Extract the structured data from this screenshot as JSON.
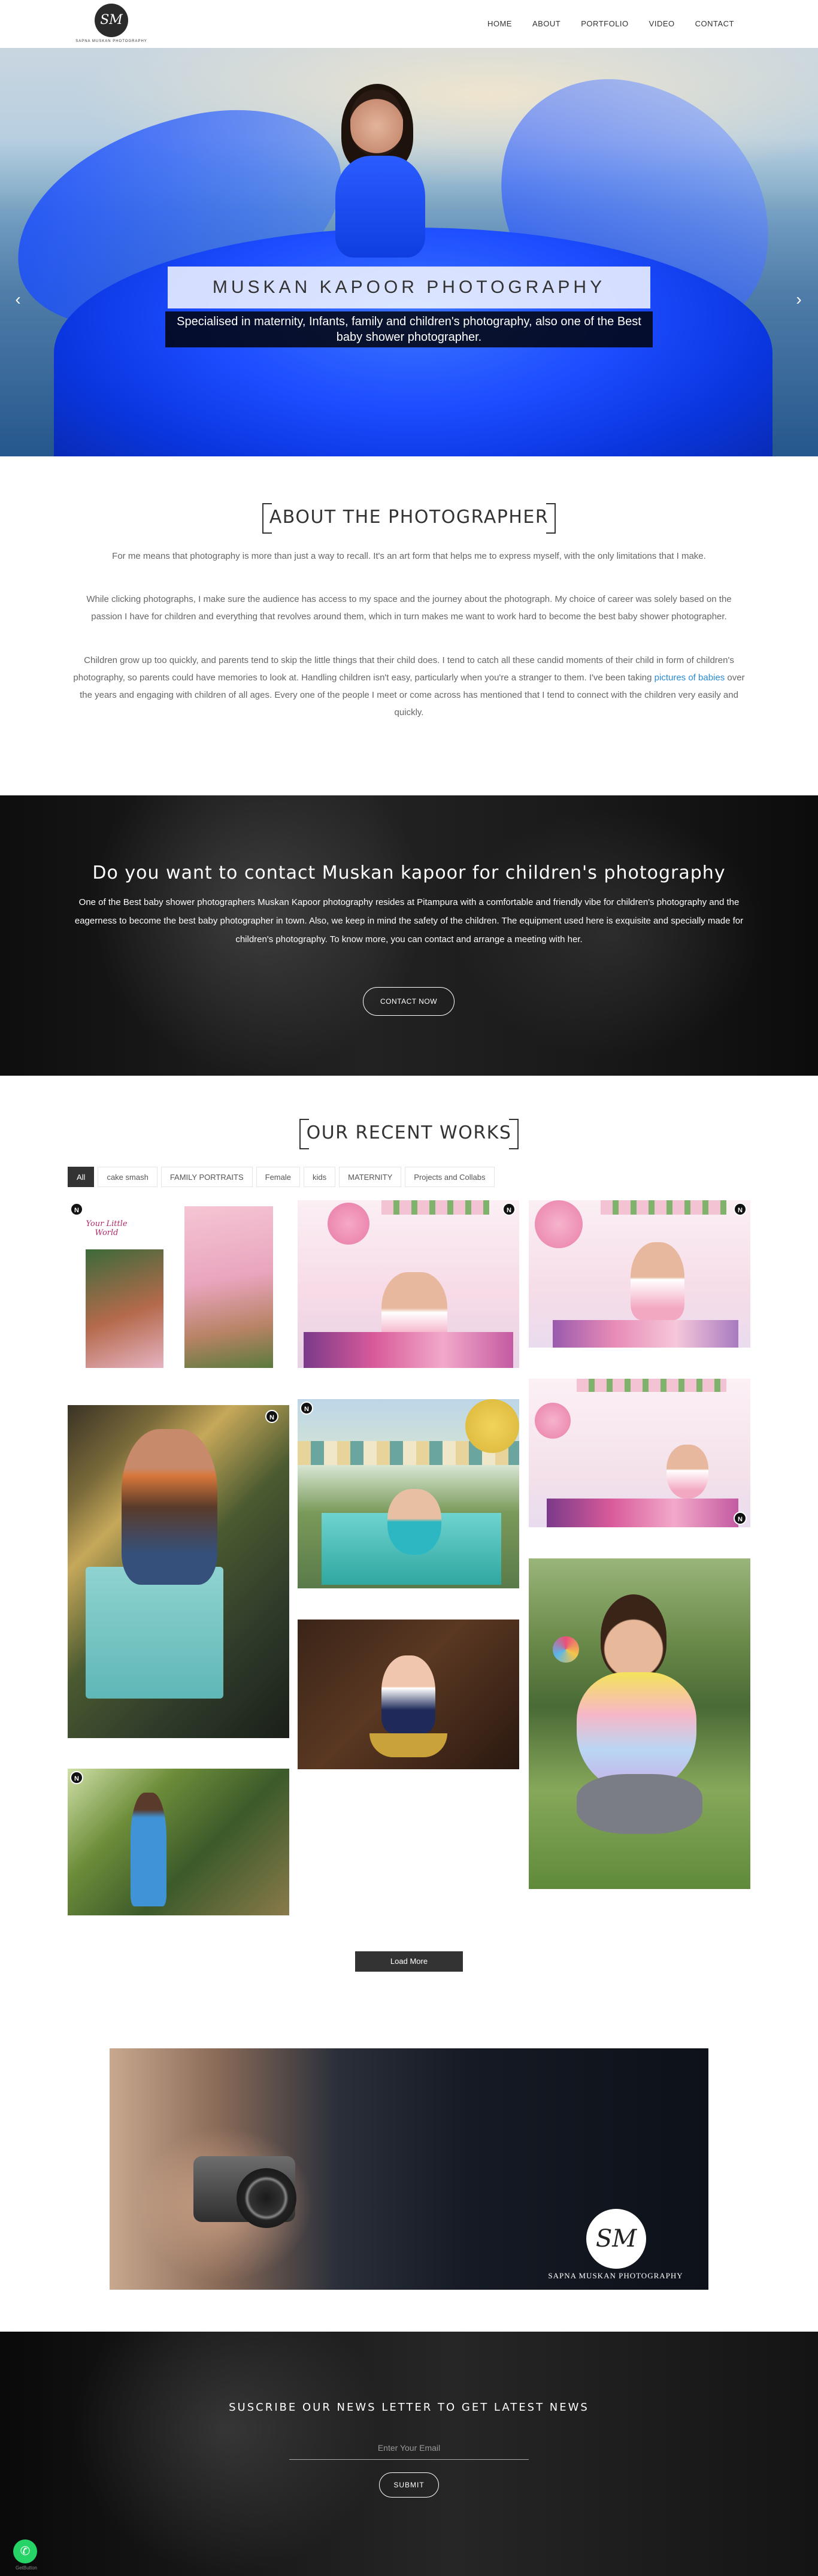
{
  "header": {
    "logo_initials": "SM",
    "logo_text": "SAPNA MUSKAN PHOTOGRAPHY",
    "nav": [
      "HOME",
      "ABOUT",
      "PORTFOLIO",
      "VIDEO",
      "CONTACT"
    ]
  },
  "hero": {
    "title": "MUSKAN KAPOOR PHOTOGRAPHY",
    "subtitle": "Specialised in maternity, Infants, family and children's photography, also one of the Best baby shower photographer.",
    "prev_arrow": "‹",
    "next_arrow": "›"
  },
  "about": {
    "heading": "ABOUT THE PHOTOGRAPHER",
    "p1": "For me means that photography is more than just a way to recall. It's an art form that helps me to express myself, with the only limitations that I make.",
    "p2": "While clicking photographs, I make sure the audience has access to my space and the journey about the photograph. My choice of career was solely based on the passion I have for children and everything that revolves around them, which in turn makes me want to work hard to become the best baby shower photographer.",
    "p3_before": "Children grow up too quickly, and parents tend to skip the little things that their child does. I tend to catch all these candid moments of their child in form of children's photography, so parents could have memories to look at. Handling children isn't easy, particularly when you're a stranger to them. I've been taking ",
    "p3_link": "pictures of babies",
    "p3_after": " over the years and engaging with children of all ages. Every one of the people I meet or come across has mentioned that I tend to connect with the children very easily and quickly."
  },
  "contact": {
    "heading": "Do you want to contact Muskan kapoor for children's photography",
    "text": "One of the Best baby shower photographers Muskan Kapoor photography resides at Pitampura with a comfortable and friendly vibe for children's photography and the eagerness to become the best baby photographer in town. Also, we keep in mind the safety of the children. The equipment used here is exquisite and specially made for children's photography. To know more, you can contact and arrange a meeting with her.",
    "button": "CONTACT NOW"
  },
  "works": {
    "heading": "OUR RECENT WORKS",
    "filters": [
      "All",
      "cake smash",
      "FAMILY PORTRAITS",
      "Female",
      "kids",
      "MATERNITY",
      "Projects and Collabs"
    ],
    "active_filter": "All",
    "badge_icon": "N",
    "collage_text": "Your Little World",
    "load_more": "Load More"
  },
  "banner": {
    "logo_initials": "SM",
    "text": "SAPNA MUSKAN PHOTOGRAPHY"
  },
  "newsletter": {
    "heading": "SUSCRIBE OUR NEWS LETTER TO GET LATEST NEWS",
    "placeholder": "Enter Your Email",
    "button": "SUBMIT"
  },
  "whatsapp": {
    "icon": "whatsapp-icon",
    "label": "GetButton"
  },
  "colors": {
    "dark": "#333333",
    "link": "#2a8ad4",
    "whatsapp": "#25d366",
    "hero_blue": "#1d4dff"
  }
}
